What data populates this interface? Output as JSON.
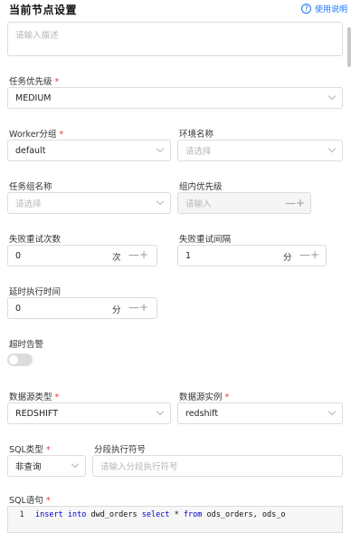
{
  "header": {
    "title": "当前节点设置",
    "help_label": "使用说明",
    "help_icon": "question-circle-icon"
  },
  "description": {
    "placeholder": "请输入描述"
  },
  "task_priority": {
    "label": "任务优先级",
    "value": "MEDIUM"
  },
  "worker_group": {
    "label": "Worker分组",
    "value": "default"
  },
  "env_name": {
    "label": "环境名称",
    "placeholder": "请选择"
  },
  "task_group_name": {
    "label": "任务组名称",
    "placeholder": "请选择"
  },
  "group_priority": {
    "label": "组内优先级",
    "placeholder": "请输入",
    "minus": "—",
    "plus": "+"
  },
  "retry_times": {
    "label": "失败重试次数",
    "value": "0",
    "unit": "次",
    "minus": "—",
    "plus": "+"
  },
  "retry_interval": {
    "label": "失败重试间隔",
    "value": "1",
    "unit": "分",
    "minus": "—",
    "plus": "+"
  },
  "delay_time": {
    "label": "延时执行时间",
    "value": "0",
    "unit": "分",
    "minus": "—",
    "plus": "+"
  },
  "timeout_alarm": {
    "label": "超时告警",
    "enabled": false
  },
  "datasource_type": {
    "label": "数据源类型",
    "value": "REDSHIFT"
  },
  "datasource_instance": {
    "label": "数据源实例",
    "value": "redshift"
  },
  "sql_type": {
    "label": "SQL类型",
    "value": "非查询"
  },
  "segment_separator": {
    "label": "分段执行符号",
    "placeholder": "请输入分段执行符号"
  },
  "sql_statement": {
    "label": "SQL语句",
    "line_number": "1",
    "code": "insert into dwd_orders select * from ods_orders, ods_o"
  },
  "required_mark": "*",
  "colors": {
    "accent": "#1677ff",
    "required": "#e53935",
    "keyword": "#0000cc"
  }
}
